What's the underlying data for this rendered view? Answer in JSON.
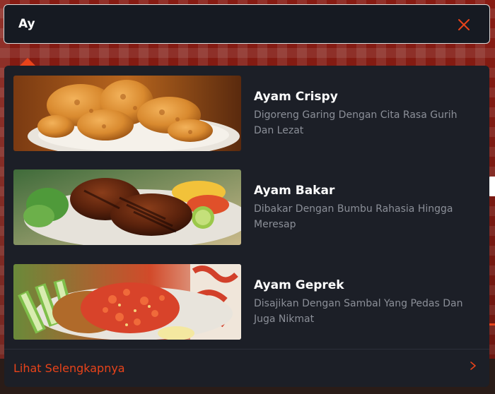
{
  "search": {
    "value": "Ay"
  },
  "results": [
    {
      "title": "Ayam Crispy",
      "description": "Digoreng Garing Dengan Cita Rasa Gurih Dan Lezat",
      "image": "fried-chicken-photo"
    },
    {
      "title": "Ayam Bakar",
      "description": "Dibakar Dengan Bumbu Rahasia Hingga Meresap",
      "image": "grilled-chicken-photo"
    },
    {
      "title": "Ayam Geprek",
      "description": "Disajikan Dengan Sambal Yang Pedas Dan Juga Nikmat",
      "image": "smashed-chicken-sambal-photo"
    }
  ],
  "see_more": {
    "label": "Lihat Selengkapnya"
  },
  "icons": {
    "close": "close-icon",
    "see_more": "chevron-right-icon"
  },
  "colors": {
    "accent": "#e8431a",
    "panel": "#1c1f27",
    "search_bg": "#161a22",
    "title_text": "#ffffff",
    "desc_text": "#8b8f98"
  }
}
